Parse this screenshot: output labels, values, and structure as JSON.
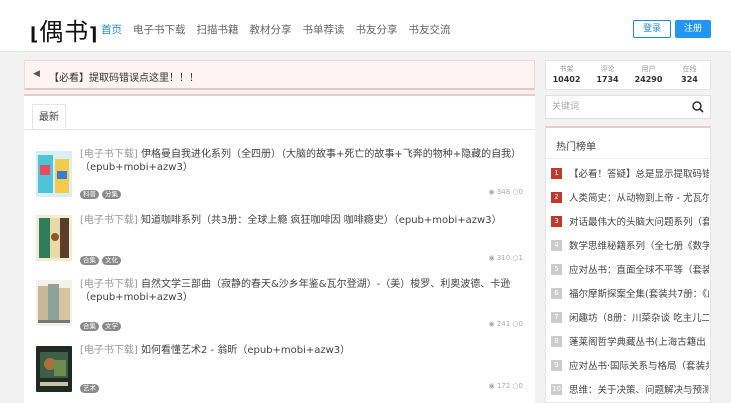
{
  "header": {
    "logo": "偶书",
    "nav": [
      "首页",
      "电子书下载",
      "扫描书籍",
      "教材分享",
      "书单荐读",
      "书友分享",
      "书友交流"
    ],
    "login": "登录",
    "register": "注册"
  },
  "notice": {
    "text": "【必看】提取码错误点这里！！！"
  },
  "tabs": {
    "latest": "最新"
  },
  "items": [
    {
      "category": "[电子书下载]",
      "title": "伊格曼自我进化系列（全四册）（大脑的故事+死亡的故事+飞奔的物种+隐藏的自我）（epub+mobi+azw3）",
      "tags": [
        "科普",
        "分集"
      ],
      "views": "348",
      "comments": "0"
    },
    {
      "category": "[电子书下载]",
      "title": "知道咖啡系列（共3册：全球上瘾 疯狂咖啡因 咖啡瘾史）（epub+mobi+azw3）",
      "tags": [
        "合集",
        "文化"
      ],
      "views": "310",
      "comments": "1"
    },
    {
      "category": "[电子书下载]",
      "title": "自然文学三部曲（寂静的春天&沙乡年鉴&瓦尔登湖）-（美）梭罗、利奥波德、卡逊（epub+mobi+azw3）",
      "tags": [
        "合集",
        "文学"
      ],
      "views": "241",
      "comments": "0"
    },
    {
      "category": "[电子书下载]",
      "title": "如何看懂艺术2 - 翁昕（epub+mobi+azw3）",
      "tags": [
        "艺术"
      ],
      "views": "172",
      "comments": "0"
    }
  ],
  "site_stats": [
    {
      "label": "书架",
      "value": "10402"
    },
    {
      "label": "评论",
      "value": "1734"
    },
    {
      "label": "用户",
      "value": "24290"
    },
    {
      "label": "在线",
      "value": "324"
    }
  ],
  "search": {
    "placeholder": "关键词"
  },
  "hot": {
    "title": "热门榜单",
    "items": [
      {
        "rank": "1",
        "text": "【必看！答疑】总是显示提取码错误"
      },
      {
        "rank": "2",
        "text": "人类简史：从动物到上帝 - 尤瓦尔·赫"
      },
      {
        "rank": "3",
        "text": "对话最伟大的头脑大问题系列（套装"
      },
      {
        "rank": "4",
        "text": "数学思维秘籍系列（全七册《数学"
      },
      {
        "rank": "5",
        "text": "应对丛书：直面全球不平等（套装共"
      },
      {
        "rank": "6",
        "text": "福尔摩斯探案全集(套装共7册：《血"
      },
      {
        "rank": "7",
        "text": "闲趣坊（8册：川菜杂谈 吃主儿二编"
      },
      {
        "rank": "8",
        "text": "蓬莱阁哲学典藏丛书(上海古籍出"
      },
      {
        "rank": "9",
        "text": "应对丛书·国际关系与格局（套装共8"
      },
      {
        "rank": "10",
        "text": "思维：关于决策、问题解决与预测"
      }
    ]
  },
  "colors": {
    "accent": "#1e88e5",
    "rank_top": "#c0392b",
    "rank_other": "#cccccc"
  }
}
